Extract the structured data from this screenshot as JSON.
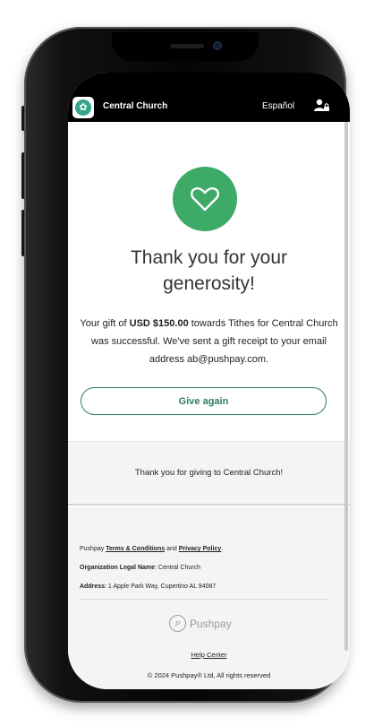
{
  "header": {
    "org_name": "Central Church",
    "language_link": "Español",
    "logo_icon": "church-logo-icon",
    "account_icon": "user-lock-icon"
  },
  "main": {
    "status_icon": "heart-icon",
    "headline": "Thank you for your generosity!",
    "message_prefix": "Your gift of ",
    "amount": "USD $150.00",
    "message_suffix": " towards Tithes for Central Church was successful. We've sent a gift receipt to your email address ab@pushpay.com.",
    "give_again_label": "Give again"
  },
  "thanks_band": {
    "text": "Thank you for giving to Central Church!"
  },
  "footer": {
    "legal_prefix": "Pushpay ",
    "terms_link": "Terms & Conditions",
    "legal_and": " and ",
    "privacy_link": "Privacy Policy",
    "legal_suffix": ".",
    "org_legal_label": "Organization Legal Name",
    "org_legal_value": ": Central Church",
    "address_label": "Address",
    "address_value": ": 1 Apple Park Way, Cupertino AL 94087",
    "brand_mark": "P",
    "brand_name": "Pushpay",
    "help_link": "Help Center",
    "copyright": "© 2024 Pushpay® Ltd, All rights reserved"
  },
  "colors": {
    "accent_green": "#3daa68",
    "button_green": "#2f7d5f",
    "header_bg": "#000000"
  }
}
